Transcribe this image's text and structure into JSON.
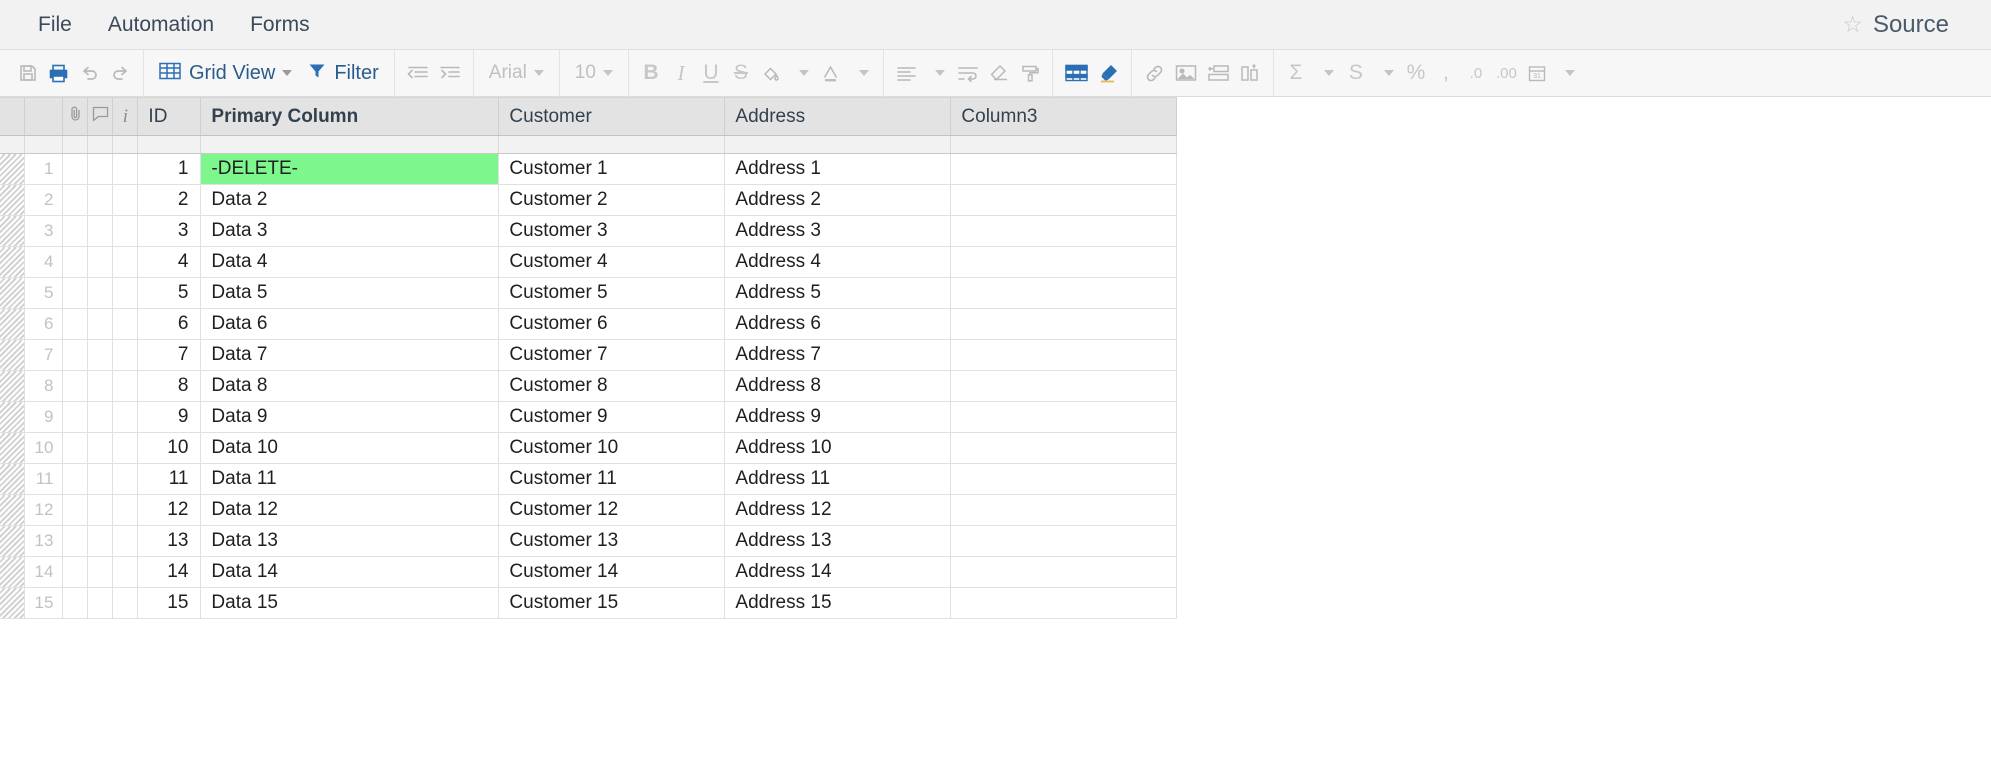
{
  "menubar": {
    "items": [
      {
        "label": "File",
        "name": "menu-file"
      },
      {
        "label": "Automation",
        "name": "menu-automation"
      },
      {
        "label": "Forms",
        "name": "menu-forms"
      }
    ],
    "source_label": "Source",
    "star_glyph": "☆"
  },
  "toolbar": {
    "save_title": "Save",
    "print_title": "Print",
    "undo_title": "Undo",
    "redo_title": "Redo",
    "view_label": "Grid View",
    "filter_label": "Filter",
    "indent_decrease_title": "Decrease Indent",
    "indent_increase_title": "Increase Indent",
    "font_name": "Arial",
    "font_size": "10",
    "bold_glyph": "B",
    "italic_glyph": "I",
    "underline_glyph": "U",
    "strike_glyph": "S",
    "fill_color_title": "Fill Color",
    "font_color_glyph": "A",
    "align_title": "Align",
    "wrap_title": "Wrap Text",
    "clear_format_title": "Clear Formatting",
    "format_painter_title": "Format Painter",
    "table_title": "Insert Table",
    "highlighter_title": "Highlighter",
    "link_title": "Insert Link",
    "image_title": "Insert Image",
    "merge_title": "Merge Cells",
    "row_height_title": "Row Height",
    "sum_glyph": "Σ",
    "currency_glyph": "S",
    "percent_glyph": "%",
    "comma_glyph": ",",
    "decimal_decrease_glyph": ".0",
    "decimal_increase_glyph": ".00",
    "date_glyph": "31"
  },
  "grid": {
    "columns": [
      {
        "key": "gutter",
        "label": "",
        "name": "column-gutter",
        "icon": ""
      },
      {
        "key": "rownum",
        "label": "",
        "name": "column-rownum",
        "icon": ""
      },
      {
        "key": "attach",
        "label": "",
        "name": "column-attachment",
        "icon": "paperclip-icon"
      },
      {
        "key": "comment",
        "label": "",
        "name": "column-comment",
        "icon": "comment-icon"
      },
      {
        "key": "info",
        "label": "",
        "name": "column-info",
        "icon": "info-icon"
      },
      {
        "key": "id",
        "label": "ID",
        "name": "column-id",
        "icon": ""
      },
      {
        "key": "primary",
        "label": "Primary Column",
        "name": "column-primary",
        "icon": ""
      },
      {
        "key": "cust",
        "label": "Customer",
        "name": "column-customer",
        "icon": ""
      },
      {
        "key": "addr",
        "label": "Address",
        "name": "column-address",
        "icon": ""
      },
      {
        "key": "col3",
        "label": "Column3",
        "name": "column-column3",
        "icon": ""
      }
    ],
    "highlight_color": "#7df78d",
    "rows": [
      {
        "rownum": "1",
        "id": "1",
        "primary": "-DELETE-",
        "cust": "Customer 1",
        "addr": "Address 1",
        "col3": "",
        "highlight": true
      },
      {
        "rownum": "2",
        "id": "2",
        "primary": "Data 2",
        "cust": "Customer 2",
        "addr": "Address 2",
        "col3": "",
        "highlight": false
      },
      {
        "rownum": "3",
        "id": "3",
        "primary": "Data 3",
        "cust": "Customer 3",
        "addr": "Address 3",
        "col3": "",
        "highlight": false
      },
      {
        "rownum": "4",
        "id": "4",
        "primary": "Data 4",
        "cust": "Customer 4",
        "addr": "Address 4",
        "col3": "",
        "highlight": false
      },
      {
        "rownum": "5",
        "id": "5",
        "primary": "Data 5",
        "cust": "Customer 5",
        "addr": "Address 5",
        "col3": "",
        "highlight": false
      },
      {
        "rownum": "6",
        "id": "6",
        "primary": "Data 6",
        "cust": "Customer 6",
        "addr": "Address 6",
        "col3": "",
        "highlight": false
      },
      {
        "rownum": "7",
        "id": "7",
        "primary": "Data 7",
        "cust": "Customer 7",
        "addr": "Address 7",
        "col3": "",
        "highlight": false
      },
      {
        "rownum": "8",
        "id": "8",
        "primary": "Data 8",
        "cust": "Customer 8",
        "addr": "Address 8",
        "col3": "",
        "highlight": false
      },
      {
        "rownum": "9",
        "id": "9",
        "primary": "Data 9",
        "cust": "Customer 9",
        "addr": "Address 9",
        "col3": "",
        "highlight": false
      },
      {
        "rownum": "10",
        "id": "10",
        "primary": "Data 10",
        "cust": "Customer 10",
        "addr": "Address 10",
        "col3": "",
        "highlight": false
      },
      {
        "rownum": "11",
        "id": "11",
        "primary": "Data 11",
        "cust": "Customer 11",
        "addr": "Address 11",
        "col3": "",
        "highlight": false
      },
      {
        "rownum": "12",
        "id": "12",
        "primary": "Data 12",
        "cust": "Customer 12",
        "addr": "Address 12",
        "col3": "",
        "highlight": false
      },
      {
        "rownum": "13",
        "id": "13",
        "primary": "Data 13",
        "cust": "Customer 13",
        "addr": "Address 13",
        "col3": "",
        "highlight": false
      },
      {
        "rownum": "14",
        "id": "14",
        "primary": "Data 14",
        "cust": "Customer 14",
        "addr": "Address 14",
        "col3": "",
        "highlight": false
      },
      {
        "rownum": "15",
        "id": "15",
        "primary": "Data 15",
        "cust": "Customer 15",
        "addr": "Address 15",
        "col3": "",
        "highlight": false
      }
    ]
  }
}
